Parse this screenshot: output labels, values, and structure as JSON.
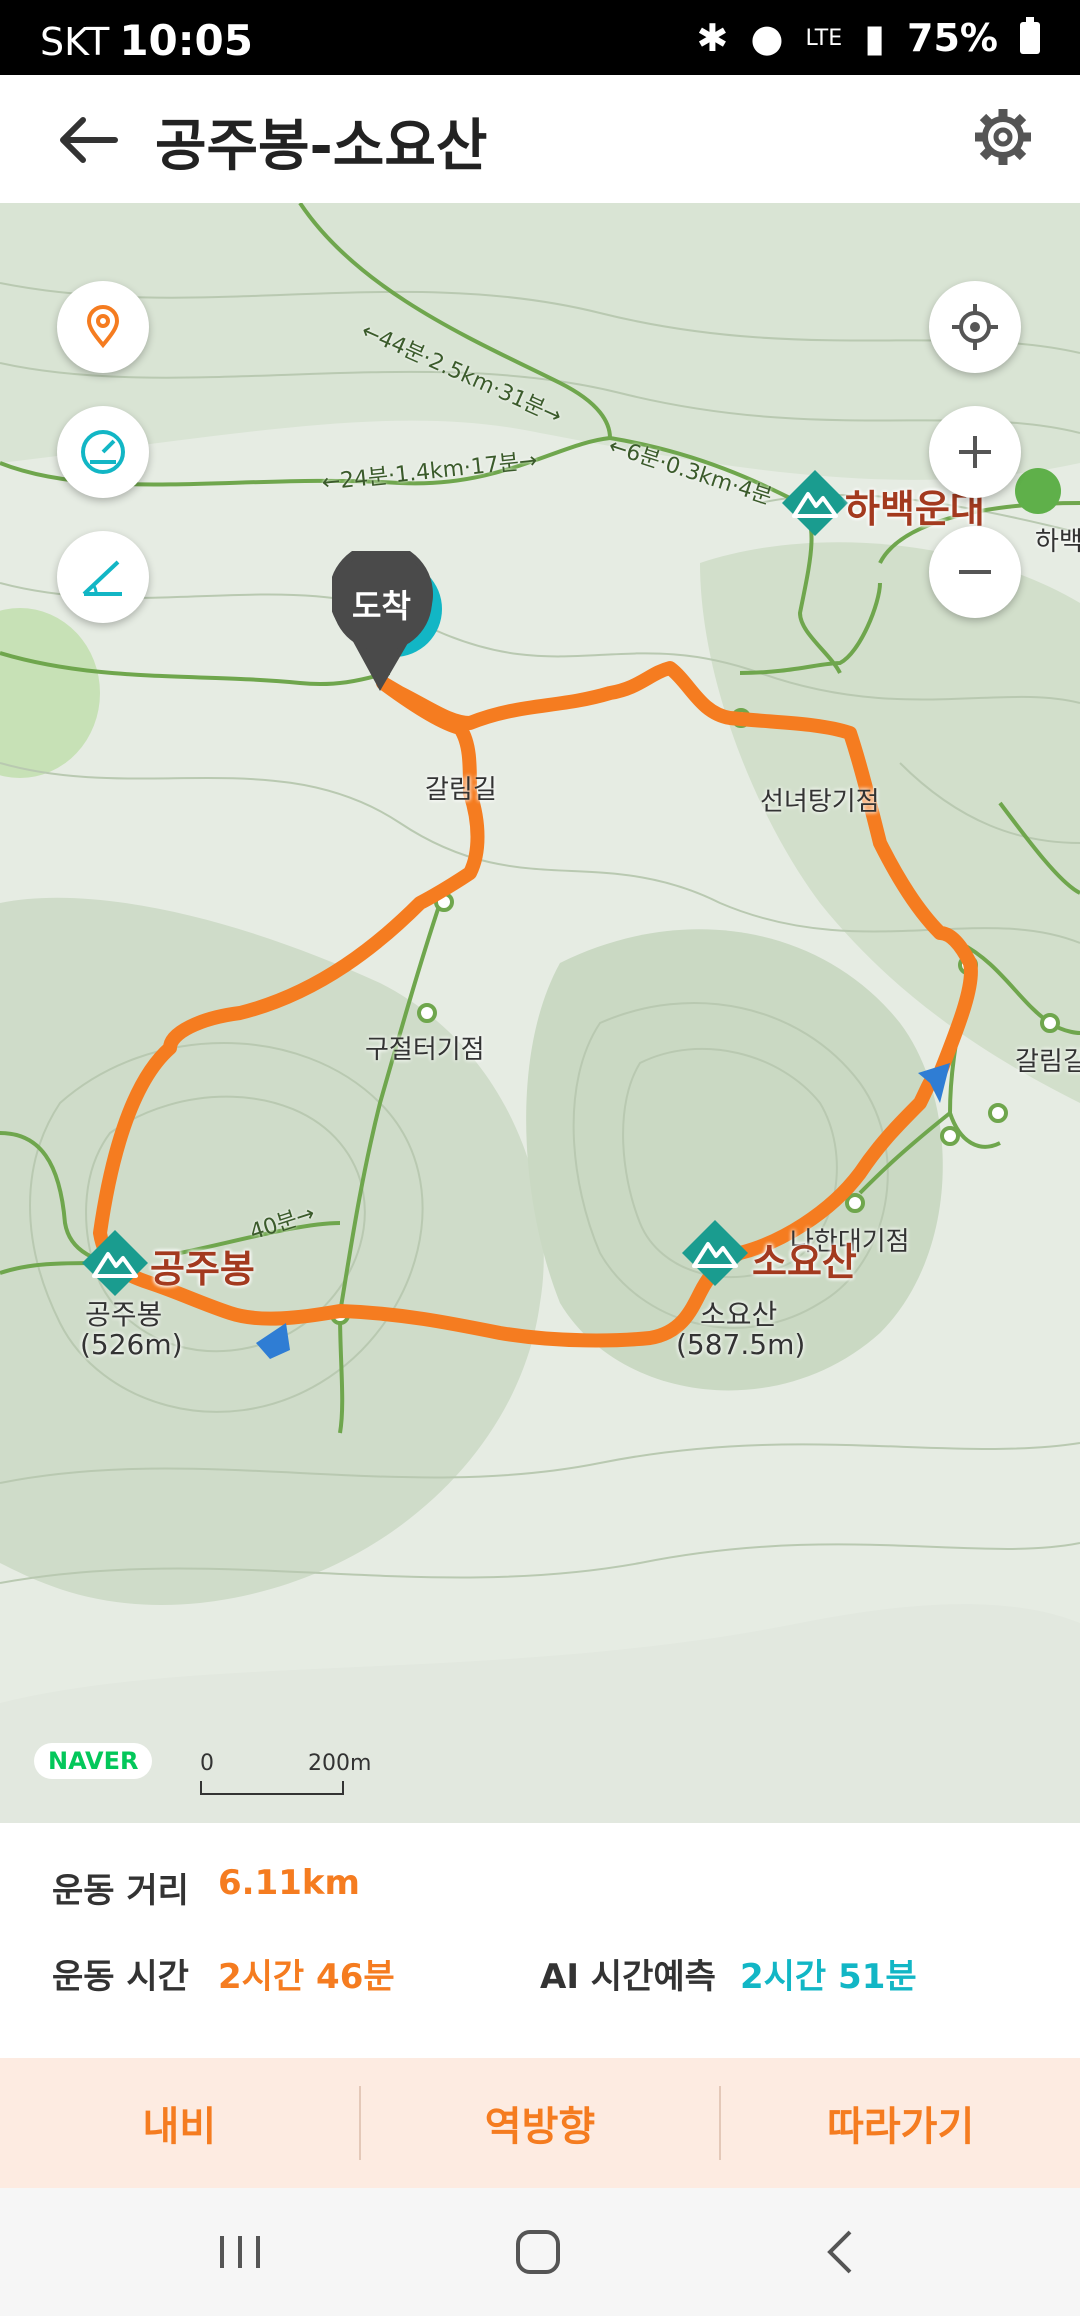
{
  "status": {
    "carrier": "SKT",
    "time": "10:05",
    "battery": "75%"
  },
  "header": {
    "title": "공주봉-소요산"
  },
  "map": {
    "peaks": [
      {
        "name": "하백운대"
      },
      {
        "name": "공주봉",
        "label": "공주봉",
        "elevation": "(526m)"
      },
      {
        "name": "소요산",
        "label": "소요산",
        "elevation": "(587.5m)"
      }
    ],
    "places": [
      "갈림길",
      "선녀탕기점",
      "구절터기점",
      "갈림길",
      "하백운대",
      "선녀탕기",
      "나한대기점"
    ],
    "trail_info": [
      "←44분·2.5km·31분→",
      "←6분·0.3km·4분",
      "←24분·1.4km·17분→",
      "40분→"
    ],
    "arrival_marker": "도착",
    "logo": "NAVER",
    "scale": {
      "start": "0",
      "end": "200m"
    }
  },
  "summary": {
    "distance_label": "운동 거리",
    "distance_value": "6.11km",
    "time_label": "운동 시간",
    "time_value": "2시간 46분",
    "ai_label": "AI 시간예측",
    "ai_value": "2시간 51분"
  },
  "actions": {
    "navi": "내비",
    "reverse": "역방향",
    "follow": "따라가기"
  },
  "colors": {
    "route": "#f57c20",
    "accent_teal": "#12b6c5"
  }
}
